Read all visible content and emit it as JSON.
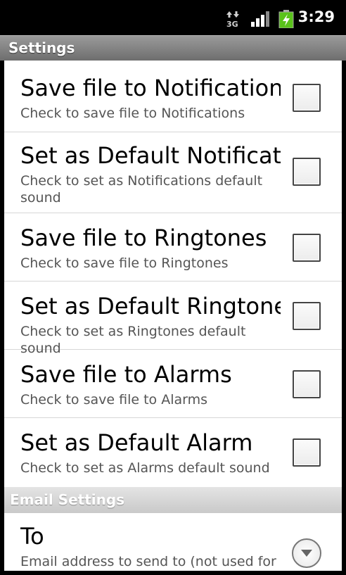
{
  "status_bar": {
    "network": "3G",
    "time": "3:29"
  },
  "title": "Settings",
  "preferences": [
    {
      "title": "Save file to Notifications",
      "summary": "Check to save file to Notifications",
      "checked": false
    },
    {
      "title": "Set as Default Notification",
      "summary": "Check to set as Notifications default sound",
      "checked": false
    },
    {
      "title": "Save file to Ringtones",
      "summary": "Check to save file to Ringtones",
      "checked": false
    },
    {
      "title": "Set as Default Ringtones",
      "summary": "Check to set as Ringtones default sound",
      "checked": false
    },
    {
      "title": "Save file to Alarms",
      "summary": "Check to save file to Alarms",
      "checked": false
    },
    {
      "title": "Set as Default Alarm",
      "summary": "Check to set as Alarms default sound",
      "checked": false
    }
  ],
  "email_section": {
    "header": "Email Settings",
    "to": {
      "title": "To",
      "summary": "Email address to send to (not used for"
    }
  },
  "colors": {
    "status_bar": "#000000",
    "battery": "#5ac31b",
    "title_bar": "#7f7f7f"
  }
}
